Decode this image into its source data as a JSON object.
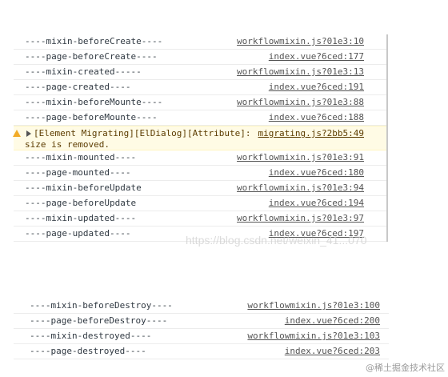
{
  "top_rows": [
    {
      "msg": "----mixin-beforeCreate----",
      "src": "workflowmixin.js?01e3:10"
    },
    {
      "msg": "----page-beforeCreate----",
      "src": "index.vue?6ced:177"
    },
    {
      "msg": "----mixin-created-----",
      "src": "workflowmixin.js?01e3:13"
    },
    {
      "msg": "----page-created----",
      "src": "index.vue?6ced:191"
    },
    {
      "msg": "----mixin-beforeMounte----",
      "src": "workflowmixin.js?01e3:88"
    },
    {
      "msg": "----page-beforeMounte----",
      "src": "index.vue?6ced:188"
    }
  ],
  "warning": {
    "line1": "[Element Migrating][ElDialog][Attribute]:",
    "line2": "size is removed.",
    "src": "migrating.js?2bb5:49",
    "icon": "warning-icon",
    "color": "#fffbe5"
  },
  "mid_rows": [
    {
      "msg": "----mixin-mounted----",
      "src": "workflowmixin.js?01e3:91"
    },
    {
      "msg": "----page-mounted----",
      "src": "index.vue?6ced:180"
    },
    {
      "msg": "----mixin-beforeUpdate",
      "src": "workflowmixin.js?01e3:94"
    },
    {
      "msg": "----page-beforeUpdate",
      "src": "index.vue?6ced:194"
    },
    {
      "msg": "----mixin-updated----",
      "src": "workflowmixin.js?01e3:97"
    },
    {
      "msg": "----page-updated----",
      "src": "index.vue?6ced:197"
    }
  ],
  "bottom_rows": [
    {
      "msg": "----mixin-beforeDestroy----",
      "src": "workflowmixin.js?01e3:100"
    },
    {
      "msg": "----page-beforeDestroy----",
      "src": "index.vue?6ced:200"
    },
    {
      "msg": "----mixin-destroyed----",
      "src": "workflowmixin.js?01e3:103"
    },
    {
      "msg": "----page-destroyed----",
      "src": "index.vue?6ced:203"
    }
  ],
  "watermark": "https://blog.csdn.net/weixin_41...070",
  "corner_watermark": "@稀土掘金技术社区"
}
